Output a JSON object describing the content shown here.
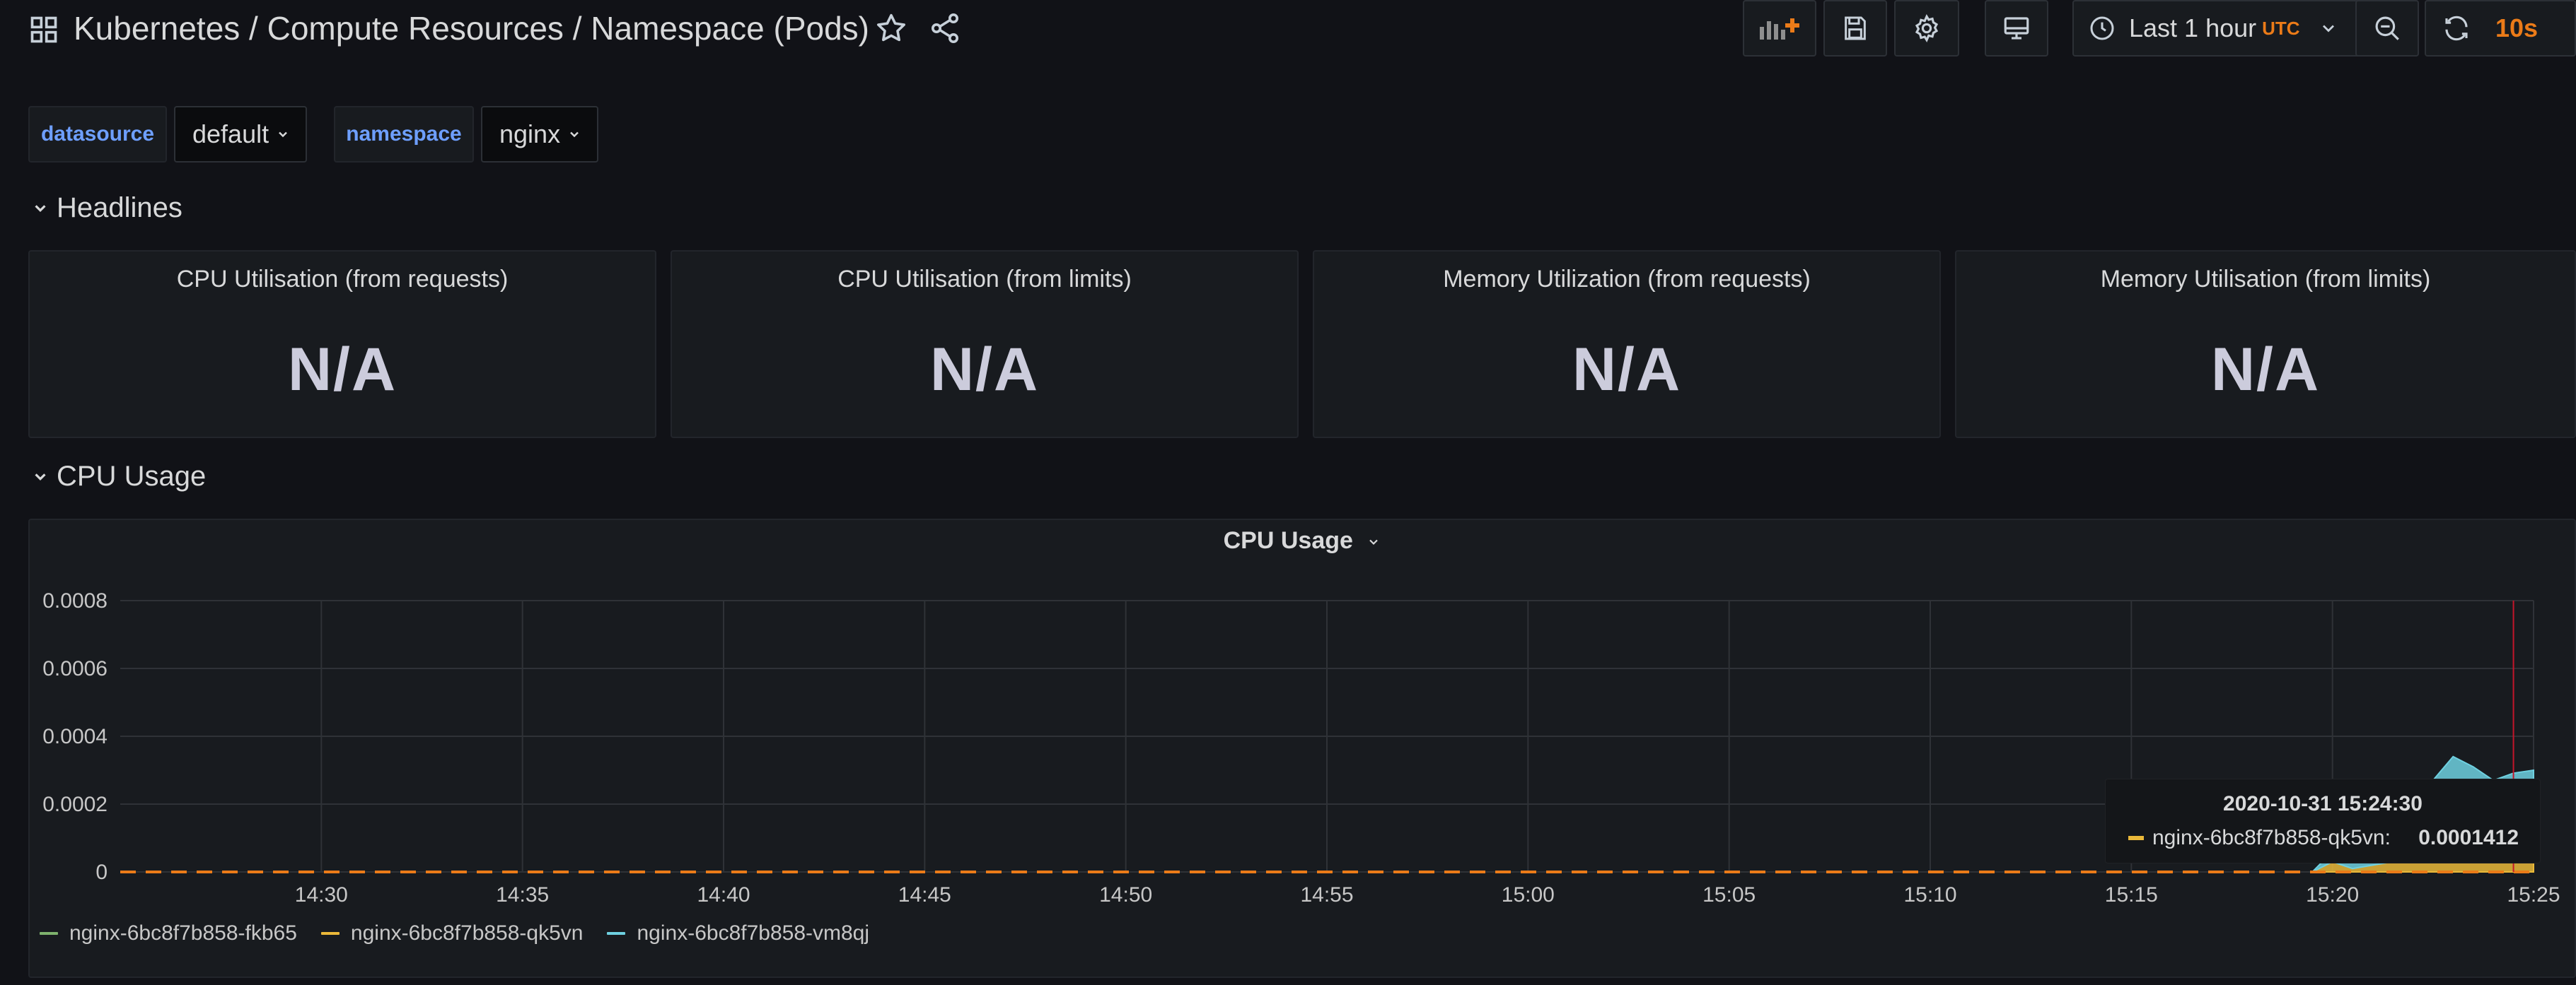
{
  "header": {
    "title": "Kubernetes / Compute Resources / Namespace (Pods)",
    "time_range": "Last 1 hour",
    "timezone": "UTC",
    "refresh_interval": "10s"
  },
  "icons": {
    "dashboard": "grid-icon",
    "star": "star-icon",
    "share": "share-icon",
    "add_panel": "add-panel-icon",
    "save": "save-icon",
    "settings": "gear-icon",
    "tv_mode": "monitor-icon",
    "clock": "clock-icon",
    "zoom_out": "zoom-out-icon",
    "refresh": "refresh-icon"
  },
  "variables": [
    {
      "label": "datasource",
      "value": "default"
    },
    {
      "label": "namespace",
      "value": "nginx"
    }
  ],
  "rows": {
    "headlines": "Headlines",
    "cpu_usage": "CPU Usage"
  },
  "stats": [
    {
      "title": "CPU Utilisation (from requests)",
      "value": "N/A"
    },
    {
      "title": "CPU Utilisation (from limits)",
      "value": "N/A"
    },
    {
      "title": "Memory Utilization (from requests)",
      "value": "N/A"
    },
    {
      "title": "Memory Utilisation (from limits)",
      "value": "N/A"
    }
  ],
  "graph": {
    "title": "CPU Usage",
    "tooltip": {
      "time": "2020-10-31 15:24:30",
      "series": "nginx-6bc8f7b858-qk5vn:",
      "value": "0.0001412"
    }
  },
  "colors": {
    "accent": "#eb7b18",
    "series_fkb65": "#7eb26d",
    "series_qk5vn": "#eab839",
    "series_vm8qj": "#6ed0e0",
    "variable_label": "#6e9fff"
  },
  "chart_data": {
    "type": "area",
    "title": "CPU Usage",
    "x": [
      "15:19:30",
      "15:20:00",
      "15:20:30",
      "15:21:00",
      "15:21:30",
      "15:22:00",
      "15:22:30",
      "15:23:00",
      "15:23:30",
      "15:24:00",
      "15:24:30",
      "15:25:00"
    ],
    "x_ticks": [
      "14:30",
      "14:35",
      "14:40",
      "14:45",
      "14:50",
      "14:55",
      "15:00",
      "15:05",
      "15:10",
      "15:15",
      "15:20",
      "15:25"
    ],
    "y_ticks": [
      "0",
      "0.0002",
      "0.0004",
      "0.0006",
      "0.0008"
    ],
    "ylim": [
      0,
      0.0008
    ],
    "x_range": [
      "14:25",
      "15:25"
    ],
    "stacked": true,
    "grid": true,
    "legend_position": "bottom-left",
    "series": [
      {
        "name": "nginx-6bc8f7b858-fkb65",
        "values": [
          0,
          0,
          0,
          0,
          0,
          0,
          0,
          0,
          0,
          0,
          0,
          0
        ]
      },
      {
        "name": "nginx-6bc8f7b858-qk5vn",
        "values": [
          0,
          3e-05,
          1e-05,
          2e-05,
          3e-05,
          7e-05,
          0.00012,
          0.00017,
          0.00018,
          0.00012,
          0.0001412,
          0.00015
        ]
      },
      {
        "name": "nginx-6bc8f7b858-vm8qj",
        "values": [
          0,
          3e-05,
          2e-05,
          6e-05,
          7e-05,
          0.00012,
          0.00015,
          0.00017,
          0.00013,
          0.00015,
          0.00015,
          0.00015
        ]
      }
    ],
    "crosshair_x": "15:24:30"
  }
}
